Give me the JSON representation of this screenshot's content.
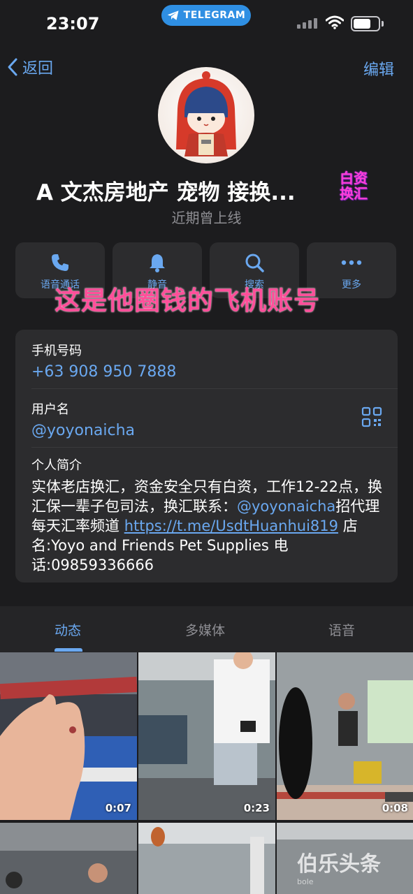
{
  "status_bar": {
    "time": "23:07",
    "app_pill": "TELEGRAM"
  },
  "nav": {
    "back_label": "返回",
    "edit_label": "编辑"
  },
  "profile": {
    "name": "A 文杰房地产 宠物 接换...",
    "name_sticker": "白资换汇",
    "last_seen": "近期曾上线"
  },
  "actions": [
    {
      "label": "语音通话",
      "icon": "phone-icon"
    },
    {
      "label": "静音",
      "icon": "bell-icon"
    },
    {
      "label": "搜索",
      "icon": "search-icon"
    },
    {
      "label": "更多",
      "icon": "more-icon"
    }
  ],
  "overlay_caption": "这是他圈钱的飞机账号",
  "info": {
    "phone_label": "手机号码",
    "phone_value": "+63 908 950 7888",
    "username_label": "用户名",
    "username_value": "@yoyonaicha",
    "bio_label": "个人简介",
    "bio_part1": "实体老店换汇，资金安全只有白资，工作12-22点，换汇保一辈子包司法，换汇联系：",
    "bio_mention": "@yoyonaicha",
    "bio_part2": "招代理 每天汇率频道 ",
    "bio_url": "https://t.me/UsdtHuanhui819",
    "bio_part3": " 店名:Yoyo and Friends Pet Supplies 电话:09859336666"
  },
  "tabs": [
    {
      "label": "动态",
      "active": true
    },
    {
      "label": "多媒体",
      "active": false
    },
    {
      "label": "语音",
      "active": false
    }
  ],
  "media": [
    {
      "duration": "0:07"
    },
    {
      "duration": "0:23"
    },
    {
      "duration": "0:08"
    }
  ],
  "watermark": {
    "text": "伯乐头条",
    "sub": "bole"
  },
  "colors": {
    "accent": "#6aa8f0",
    "background": "#1c1c1e",
    "card": "#2c2c2e",
    "overlay": "#ff4f9a",
    "telegram_blue": "#2f8fe3"
  }
}
